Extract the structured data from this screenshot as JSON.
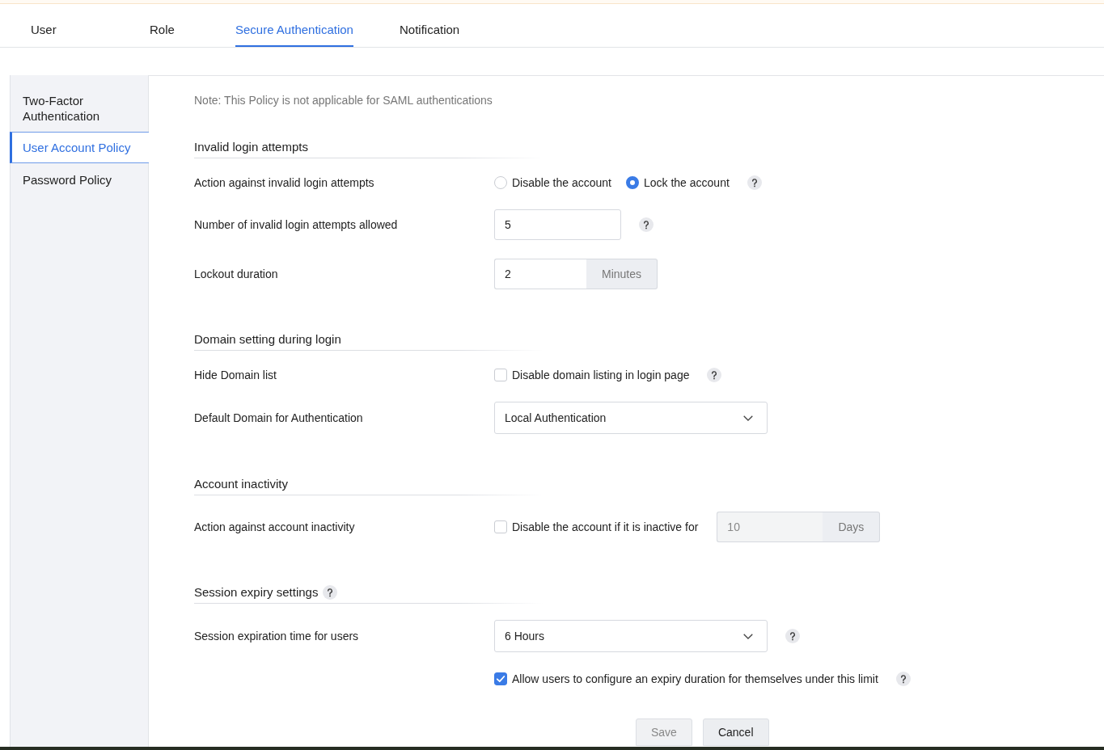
{
  "tabs": [
    {
      "label": "User",
      "selected": false
    },
    {
      "label": "Role",
      "selected": false
    },
    {
      "label": "Secure Authentication",
      "selected": true
    },
    {
      "label": "Notification",
      "selected": false
    }
  ],
  "sidebar": {
    "items": [
      {
        "label": "Two-Factor Authentication",
        "selected": false
      },
      {
        "label": "User Account Policy",
        "selected": true
      },
      {
        "label": "Password Policy",
        "selected": false
      }
    ]
  },
  "note": "Note: This Policy is not applicable for SAML authentications",
  "sections": [
    {
      "title": "Invalid login attempts",
      "rows": [
        {
          "label": "Action against invalid login attempts",
          "controls": [
            {
              "kind": "radio",
              "label": "Disable the account",
              "selected": false
            },
            {
              "kind": "radio",
              "label": "Lock the account",
              "selected": true
            }
          ],
          "help": true
        },
        {
          "label": "Number of invalid login attempts allowed",
          "controls": [
            {
              "kind": "input",
              "value": "5"
            }
          ],
          "help": true
        },
        {
          "label": "Lockout duration",
          "controls": [
            {
              "kind": "input",
              "value": "2",
              "unit": "Minutes"
            }
          ]
        }
      ]
    },
    {
      "title": "Domain setting during login",
      "rows": [
        {
          "label": "Hide Domain list",
          "controls": [
            {
              "kind": "checkbox",
              "label": "Disable domain listing in login page",
              "checked": false
            }
          ],
          "help": true
        },
        {
          "label": "Default Domain for Authentication",
          "controls": [
            {
              "kind": "select",
              "value": "Local Authentication"
            }
          ]
        }
      ]
    },
    {
      "title": "Account inactivity",
      "rows": [
        {
          "label": "Action against account inactivity",
          "controls": [
            {
              "kind": "checkbox",
              "label": "Disable the account if it is inactive for",
              "checked": false
            },
            {
              "kind": "input",
              "value": "10",
              "unit": "Days",
              "disabled": true
            }
          ]
        }
      ]
    },
    {
      "title": "Session expiry settings",
      "help": true,
      "rows": [
        {
          "label": "Session expiration time for users",
          "controls": [
            {
              "kind": "select",
              "value": "6 Hours"
            }
          ],
          "help": true
        },
        {
          "controls": [
            {
              "kind": "checkbox",
              "label": "Allow users to configure an expiry duration for themselves under this limit",
              "checked": true
            }
          ],
          "help": true
        }
      ]
    }
  ],
  "buttons": [
    {
      "label": "Save",
      "disabled": true
    },
    {
      "label": "Cancel",
      "disabled": false
    }
  ]
}
